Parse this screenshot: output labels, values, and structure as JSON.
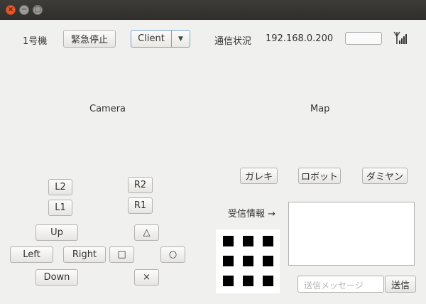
{
  "titlebar": {
    "close": "×",
    "minimize": "−",
    "maximize": "□"
  },
  "header": {
    "unit_label": "1号機",
    "emergency_stop": "緊急停止",
    "mode_selected": "Client",
    "comm_label": "通信状況",
    "ip_address": "192.168.0.200"
  },
  "panels": {
    "camera": "Camera",
    "map": "Map"
  },
  "map_buttons": {
    "rubble": "ガレキ",
    "robot": "ロボット",
    "dummy": "ダミヤン"
  },
  "controller": {
    "l2": "L2",
    "l1": "L1",
    "r2": "R2",
    "r1": "R1",
    "up": "Up",
    "left": "Left",
    "right": "Right",
    "down": "Down",
    "triangle": "△",
    "square": "□",
    "circle": "○",
    "cross": "×"
  },
  "receive": {
    "label": "受信情報 →"
  },
  "send": {
    "placeholder": "送信メッセージ",
    "button": "送信"
  },
  "icons": {
    "signal": "signal-icon",
    "dropdown": "chevron-down-icon"
  },
  "matrix_cells": 9
}
